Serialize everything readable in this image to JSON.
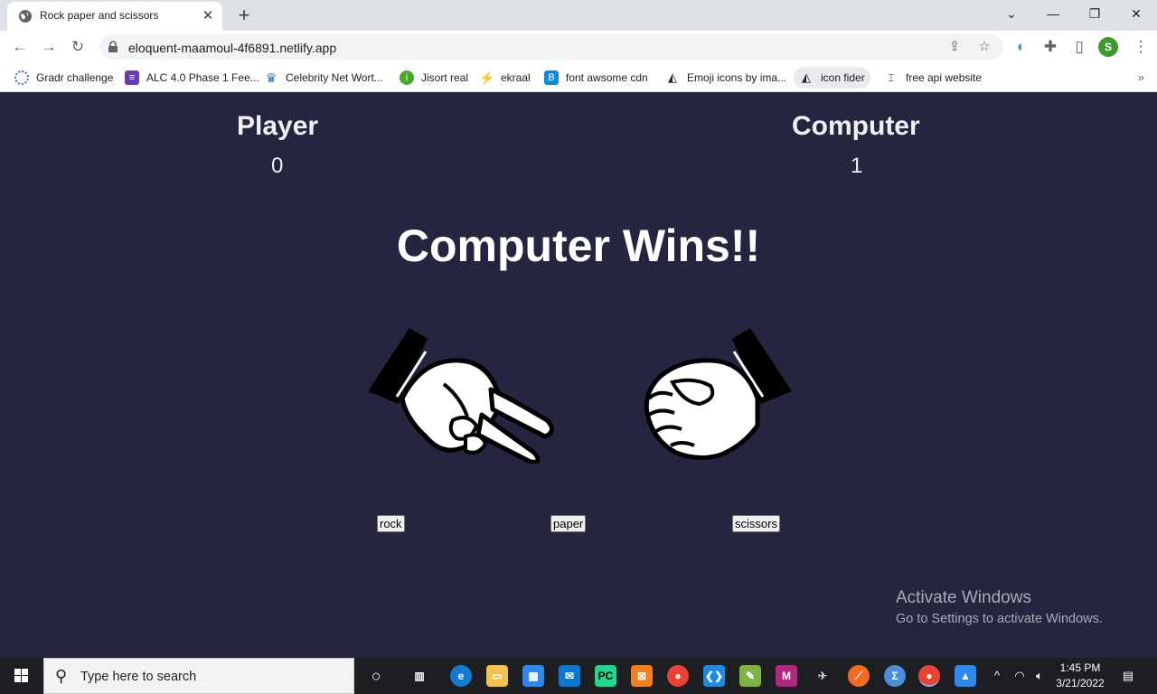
{
  "browser": {
    "tab_title": "Rock paper and scissors",
    "url": "eloquent-maamoul-4f6891.netlify.app",
    "profile_initial": "S",
    "bookmarks": [
      {
        "label": "Gradr challenge",
        "icon": "gradr-icon"
      },
      {
        "label": "ALC 4.0 Phase 1 Fee...",
        "icon": "forms-icon"
      },
      {
        "label": "Celebrity Net Wort...",
        "icon": "crown-icon"
      },
      {
        "label": "Jisort real",
        "icon": "jisort-icon"
      },
      {
        "label": "ekraal",
        "icon": "ekraal-icon"
      },
      {
        "label": "font awsome cdn",
        "icon": "bootstrap-icon"
      },
      {
        "label": "Emoji icons by ima...",
        "icon": "emoji-icon"
      },
      {
        "label": "icon fider",
        "icon": "icon-fider-icon"
      },
      {
        "label": "free api website",
        "icon": "api-icon"
      }
    ]
  },
  "game": {
    "player_label": "Player",
    "player_score": "0",
    "computer_label": "Computer",
    "computer_score": "1",
    "result": "Computer Wins!!",
    "player_hand": "scissors",
    "computer_hand": "rock",
    "buttons": {
      "rock": "rock",
      "paper": "paper",
      "scissors": "scissors"
    }
  },
  "watermark": {
    "line1": "Activate Windows",
    "line2": "Go to Settings to activate Windows."
  },
  "taskbar": {
    "search_placeholder": "Type here to search",
    "time": "1:45 PM",
    "date": "3/21/2022"
  },
  "colors": {
    "page_background": "#25253f",
    "text": "#ffffff"
  }
}
